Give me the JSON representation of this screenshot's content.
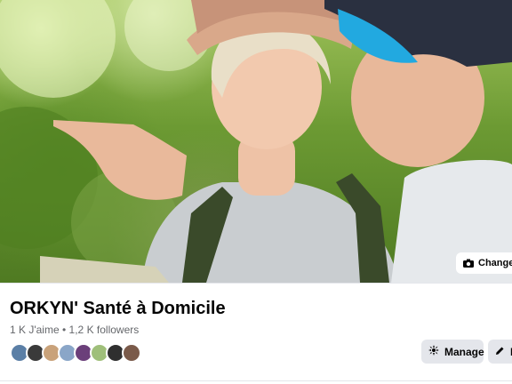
{
  "page": {
    "name": "ORKYN' Santé à Domicile",
    "likes": "1 K J'aime",
    "separator": "•",
    "followers": "1,2 K followers"
  },
  "cover": {
    "change_button_label": "Changer"
  },
  "actions": {
    "manage_label": "Manage",
    "edit_label": "E"
  },
  "avatars": [
    {
      "color": "#5b7fa6"
    },
    {
      "color": "#3a3a3a"
    },
    {
      "color": "#c9a27a"
    },
    {
      "color": "#8aa6c8"
    },
    {
      "color": "#6b3f7a"
    },
    {
      "color": "#9fbf7a"
    },
    {
      "color": "#2f2f2f"
    },
    {
      "color": "#7a5a4a"
    }
  ],
  "colors": {
    "text_primary": "#050505",
    "text_secondary": "#65676b",
    "button_bg": "#e4e6eb"
  }
}
